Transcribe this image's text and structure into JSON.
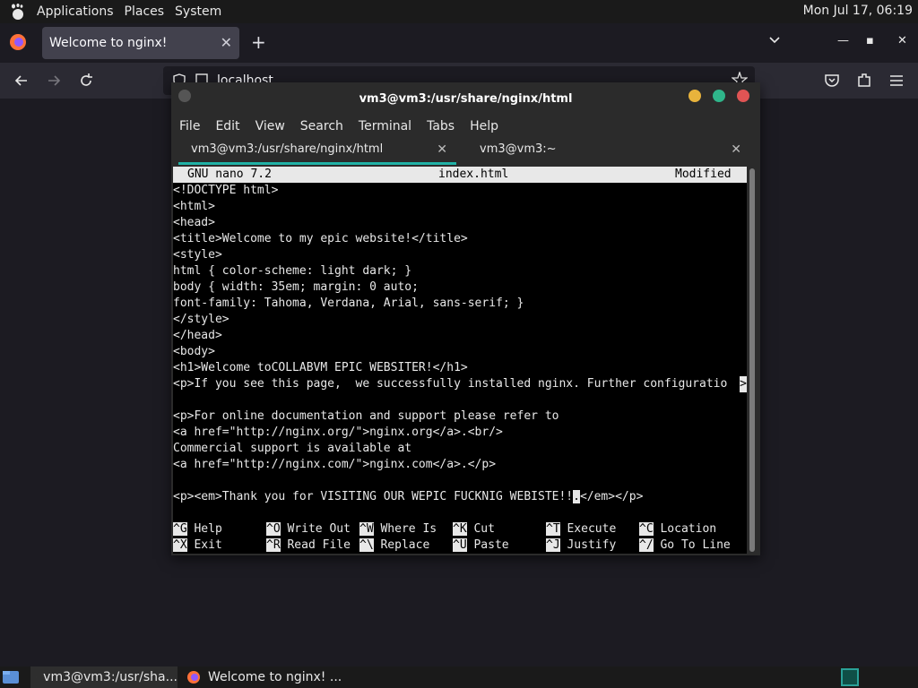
{
  "top_panel": {
    "menus": [
      "Applications",
      "Places",
      "System"
    ],
    "clock": "Mon Jul 17, 06:19"
  },
  "firefox": {
    "tab_title": "Welcome to nginx!",
    "tab_close": "✕",
    "new_tab": "+",
    "url": "localhost",
    "window_controls": {
      "minimize": "—",
      "maximize": "▪",
      "close": "✕"
    }
  },
  "terminal": {
    "title": "vm3@vm3:/usr/share/nginx/html",
    "menus": [
      "File",
      "Edit",
      "View",
      "Search",
      "Terminal",
      "Tabs",
      "Help"
    ],
    "tabs": [
      {
        "label": "vm3@vm3:/usr/share/nginx/html",
        "close": "✕"
      },
      {
        "label": "vm3@vm3:~",
        "close": "✕"
      }
    ],
    "buttons": {
      "minimize": "#e8b33c",
      "maximize": "#2fb58a",
      "close": "#e05454"
    }
  },
  "nano": {
    "version": "GNU nano 7.2",
    "filename": "index.html",
    "status": "Modified",
    "lines": [
      "<!DOCTYPE html>",
      "<html>",
      "<head>",
      "<title>Welcome to my epic website!</title>",
      "<style>",
      "html { color-scheme: light dark; }",
      "body { width: 35em; margin: 0 auto;",
      "font-family: Tahoma, Verdana, Arial, sans-serif; }",
      "</style>",
      "</head>",
      "<body>",
      "<h1>Welcome toCOLLABVM EPIC WEBSITER!</h1>",
      "<p>If you see this page,  we successfully installed nginx. Further configuratio",
      "",
      "<p>For online documentation and support please refer to",
      "<a href=\"http://nginx.org/\">nginx.org</a>.<br/>",
      "Commercial support is available at",
      "<a href=\"http://nginx.com/\">nginx.com</a>.</p>",
      "",
      "<p><em>Thank you for VISITING OUR WEPIC FUCKNIG WEBISTE!!",
      "",
      ""
    ],
    "cursor_char": ".",
    "cursor_after": "</em></p>",
    "truncation_marker": ">",
    "shortcuts_row1": [
      {
        "key": "^G",
        "label": "Help"
      },
      {
        "key": "^O",
        "label": "Write Out"
      },
      {
        "key": "^W",
        "label": "Where Is"
      },
      {
        "key": "^K",
        "label": "Cut"
      },
      {
        "key": "^T",
        "label": "Execute"
      },
      {
        "key": "^C",
        "label": "Location"
      }
    ],
    "shortcuts_row2": [
      {
        "key": "^X",
        "label": "Exit"
      },
      {
        "key": "^R",
        "label": "Read File"
      },
      {
        "key": "^\\",
        "label": "Replace"
      },
      {
        "key": "^U",
        "label": "Paste"
      },
      {
        "key": "^J",
        "label": "Justify"
      },
      {
        "key": "^/",
        "label": "Go To Line"
      }
    ]
  },
  "taskbar": {
    "items": [
      "vm3@vm3:/usr/sha...",
      "Welcome to nginx! ..."
    ]
  }
}
